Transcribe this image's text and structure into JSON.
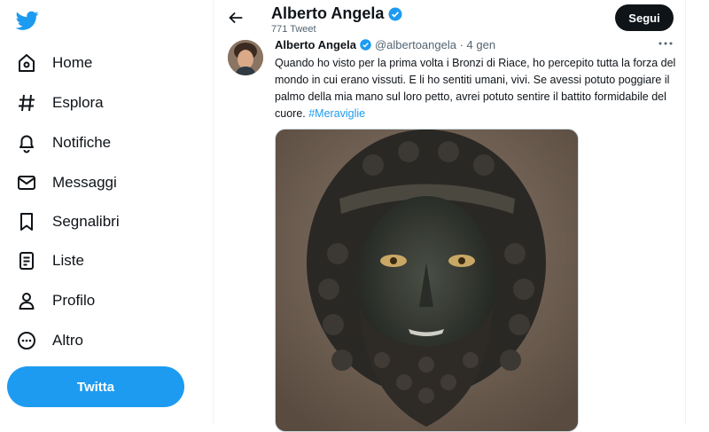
{
  "sidebar": {
    "items": [
      {
        "label": "Home",
        "icon": "home-icon"
      },
      {
        "label": "Esplora",
        "icon": "hashtag-icon"
      },
      {
        "label": "Notifiche",
        "icon": "bell-icon"
      },
      {
        "label": "Messaggi",
        "icon": "envelope-icon"
      },
      {
        "label": "Segnalibri",
        "icon": "bookmark-icon"
      },
      {
        "label": "Liste",
        "icon": "list-icon"
      },
      {
        "label": "Profilo",
        "icon": "person-icon"
      },
      {
        "label": "Altro",
        "icon": "more-circle-icon"
      }
    ],
    "tweet_button": "Twitta"
  },
  "header": {
    "name": "Alberto Angela",
    "tweet_count": "771 Tweet",
    "follow_label": "Segui"
  },
  "tweet": {
    "author_name": "Alberto Angela",
    "handle": "@albertoangela",
    "separator": " · ",
    "date": "4 gen",
    "text": "Quando ho visto per la prima volta i Bronzi di Riace, ho percepito tutta la forza del mondo in cui erano vissuti. E li ho sentiti umani, vivi. Se avessi potuto poggiare il palmo della mia mano sul loro petto, avrei potuto sentire il battito formidabile del cuore. ",
    "hashtag": "#Meraviglie"
  },
  "colors": {
    "accent": "#1d9bf0",
    "text": "#0f1419",
    "secondary": "#536471"
  }
}
